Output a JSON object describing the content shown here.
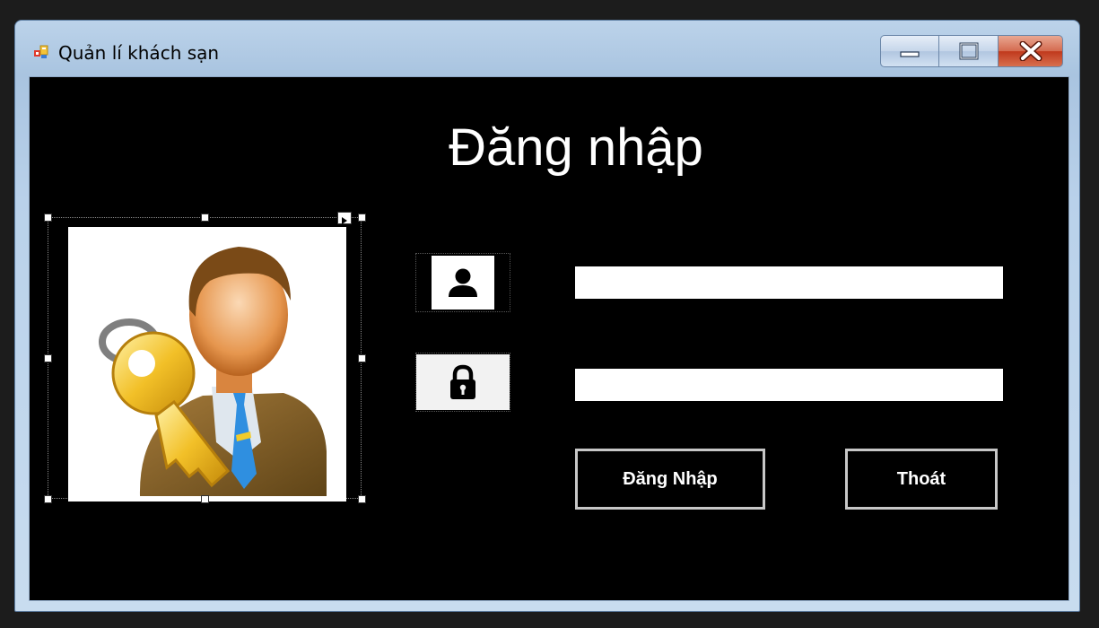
{
  "window": {
    "title": "Quản lí khách sạn"
  },
  "form": {
    "heading": "Đăng nhập",
    "username_value": "",
    "password_value": "",
    "login_button": "Đăng Nhập",
    "exit_button": "Thoát"
  },
  "icons": {
    "app": "app-form-icon",
    "user": "user-icon",
    "lock": "lock-icon",
    "picture": "user-with-key-illustration"
  },
  "colors": {
    "client_background": "#000000",
    "text": "#ffffff",
    "button_border": "#c7c7c7"
  }
}
